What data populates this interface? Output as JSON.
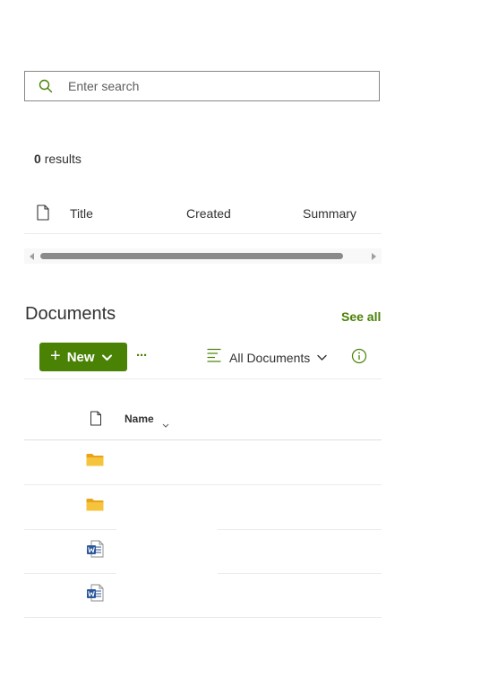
{
  "search": {
    "placeholder": "Enter search",
    "value": ""
  },
  "results": {
    "count": "0",
    "label": "results"
  },
  "results_table": {
    "columns": [
      "Title",
      "Created",
      "Summary"
    ]
  },
  "documents": {
    "title": "Documents",
    "see_all": "See all",
    "new_label": "New",
    "more_label": "···",
    "view_label": "All Documents",
    "list": {
      "name_header": "Name",
      "rows": [
        {
          "type": "folder",
          "icon": "folder-icon",
          "name": ""
        },
        {
          "type": "folder",
          "icon": "folder-icon",
          "name": ""
        },
        {
          "type": "word",
          "icon": "word-doc-icon",
          "name": ""
        },
        {
          "type": "word",
          "icon": "word-doc-icon",
          "name": ""
        }
      ]
    }
  },
  "colors": {
    "accent": "#498205",
    "folder": "#f6c33d",
    "word": "#2b579a"
  }
}
